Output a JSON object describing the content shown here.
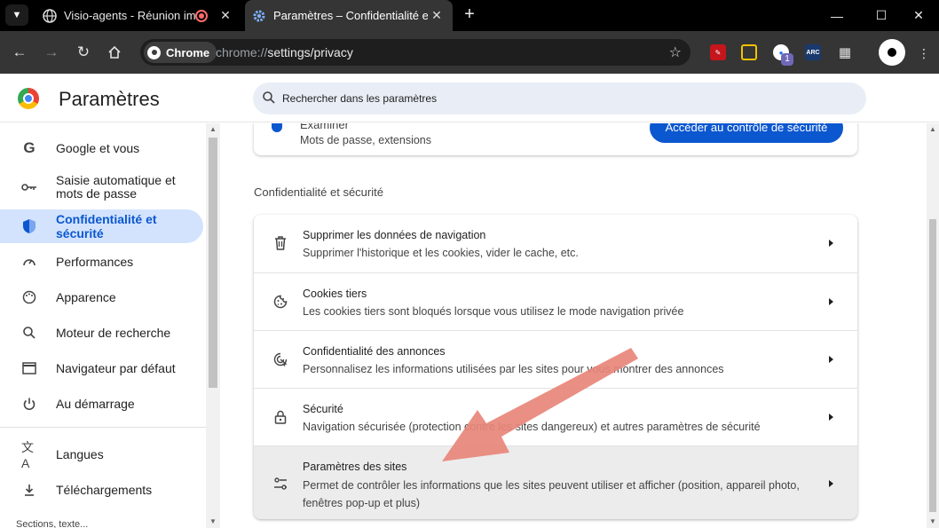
{
  "tabs": [
    {
      "title": "Visio-agents - Réunion impr",
      "state": "inactive"
    },
    {
      "title": "Paramètres – Confidentialité et",
      "state": "active"
    }
  ],
  "toolbar": {
    "chip_label": "Chrome",
    "url_scheme": "chrome://",
    "url_path": "settings/privacy",
    "ext_arc": "ARC",
    "ext_badge": "1"
  },
  "header": {
    "title": "Paramètres",
    "search_placeholder": "Rechercher dans les paramètres"
  },
  "sidebar": {
    "items": [
      {
        "label": "Google et vous",
        "icon": "google-icon"
      },
      {
        "label": "Saisie automatique et mots de passe",
        "icon": "key-icon"
      },
      {
        "label": "Confidentialité et sécurité",
        "icon": "shield-icon",
        "active": true
      },
      {
        "label": "Performances",
        "icon": "gauge-icon"
      },
      {
        "label": "Apparence",
        "icon": "palette-icon"
      },
      {
        "label": "Moteur de recherche",
        "icon": "search-icon"
      },
      {
        "label": "Navigateur par défaut",
        "icon": "browser-icon"
      },
      {
        "label": "Au démarrage",
        "icon": "power-icon"
      },
      {
        "label": "Langues",
        "icon": "translate-icon"
      },
      {
        "label": "Téléchargements",
        "icon": "download-icon"
      }
    ],
    "clipped_text": "Sections, texte..."
  },
  "main": {
    "top_card": {
      "line1": "Examiner",
      "line2": "Mots de passe, extensions",
      "button": "Accéder au contrôle de sécurité"
    },
    "section_title": "Confidentialité et sécurité",
    "rows": [
      {
        "title": "Supprimer les données de navigation",
        "subtitle": "Supprimer l'historique et les cookies, vider le cache, etc.",
        "icon": "trash-icon"
      },
      {
        "title": "Cookies tiers",
        "subtitle": "Les cookies tiers sont bloqués lorsque vous utilisez le mode navigation privée",
        "icon": "cookie-icon"
      },
      {
        "title": "Confidentialité des annonces",
        "subtitle": "Personnalisez les informations utilisées par les sites pour vous montrer des annonces",
        "icon": "ads-icon"
      },
      {
        "title": "Sécurité",
        "subtitle": "Navigation sécurisée (protection contre les sites dangereux) et autres paramètres de sécurité",
        "icon": "lock-icon"
      },
      {
        "title": "Paramètres des sites",
        "subtitle": "Permet de contrôler les informations que les sites peuvent utiliser et afficher (position, appareil photo, fenêtres pop-up et plus)",
        "icon": "sliders-icon",
        "hover": true
      }
    ]
  },
  "colors": {
    "accent": "#0b57d0",
    "active_bg": "#d3e3fd",
    "annotation_arrow": "#e8857a"
  }
}
